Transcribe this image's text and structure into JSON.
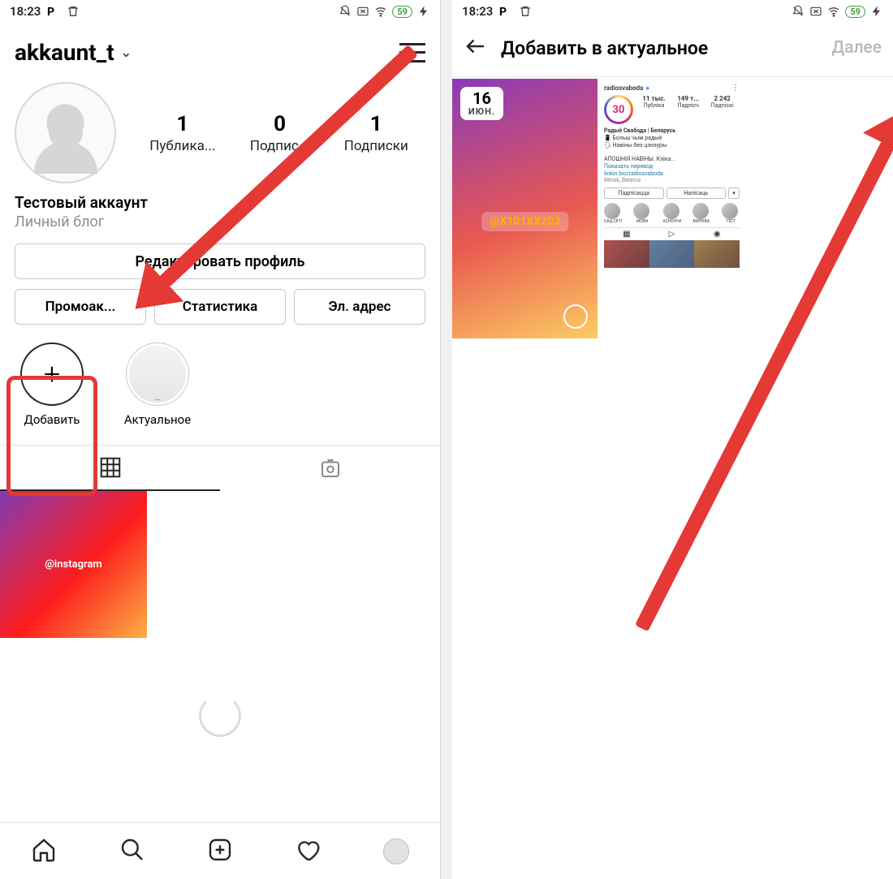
{
  "status": {
    "time": "18:23",
    "battery": "59"
  },
  "left": {
    "username": "akkaunt_t",
    "stats": {
      "posts_num": "1",
      "posts_label": "Публика...",
      "followers_num": "0",
      "followers_label": "Подпис...",
      "following_num": "1",
      "following_label": "Подписки"
    },
    "bio": {
      "name": "Тестовый аккаунт",
      "category": "Личный блог"
    },
    "buttons": {
      "edit": "Редактировать профиль",
      "promo": "Промоак...",
      "stats": "Статистика",
      "email": "Эл. адрес"
    },
    "highlights": {
      "add_label": "Добавить",
      "actual_label": "Актуальное"
    },
    "feed": {
      "item1_text": "@instagram"
    }
  },
  "right": {
    "title": "Добавить в актуальное",
    "next": "Далее",
    "story1": {
      "day": "16",
      "month": "июн.",
      "mention": "@X101XX203"
    },
    "story2": {
      "day": "30",
      "handle": "radiosvaboda",
      "posts": "11 тыс.",
      "followers": "149 т...",
      "following": "2 242",
      "posts_l": "Публіка",
      "followers_l": "Падпісч",
      "following_l": "Падпіскі",
      "bio_name": "Радыё Свабода | Беларусь",
      "bio_line1": "📱 Больш чым радыё",
      "bio_line2": "🗣 Навіны без цэнзуры",
      "bio_news": "АПОШНІЯ НАВІНЫ. Кліка...",
      "bio_trans": "Показать перевод",
      "bio_link": "linkin.bio/radiosvaboda",
      "bio_loc": "Minsk, Belarus",
      "btn_follow": "Падпісацца",
      "btn_msg": "Напісаць",
      "hi": [
        "САЦ.СЕТКІ",
        "МОВА",
        "АСНОЎНАЕ",
        "МОРКВА",
        "ТЭСТ"
      ]
    }
  }
}
